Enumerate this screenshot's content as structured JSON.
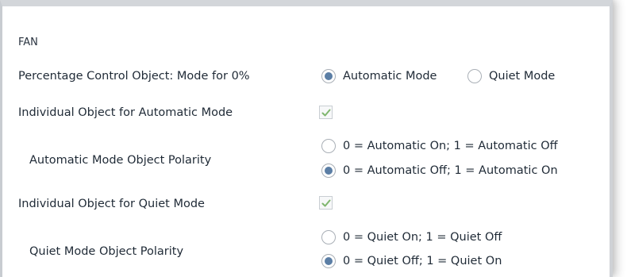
{
  "section": {
    "title": "FAN"
  },
  "percentage_control": {
    "label": "Percentage Control Object: Mode for 0%",
    "options": [
      {
        "label": "Automatic Mode",
        "selected": true
      },
      {
        "label": "Quiet Mode",
        "selected": false
      }
    ]
  },
  "automatic_individual": {
    "label": "Individual Object for Automatic Mode",
    "checked": true
  },
  "automatic_polarity": {
    "label": "Automatic Mode Object Polarity",
    "options": [
      {
        "label": "0 = Automatic On; 1 = Automatic Off",
        "selected": false
      },
      {
        "label": "0 = Automatic Off; 1 = Automatic On",
        "selected": true
      }
    ]
  },
  "quiet_individual": {
    "label": "Individual Object for Quiet Mode",
    "checked": true
  },
  "quiet_polarity": {
    "label": "Quiet Mode Object Polarity",
    "options": [
      {
        "label": "0 = Quiet On; 1 = Quiet Off",
        "selected": false
      },
      {
        "label": "0 = Quiet Off; 1 = Quiet On",
        "selected": true
      }
    ]
  },
  "colors": {
    "radio_dot": "#5b7ea5",
    "checkmark": "#7fb66e",
    "text": "#1f2a36"
  },
  "icons": {
    "checkmark": "check-icon"
  }
}
